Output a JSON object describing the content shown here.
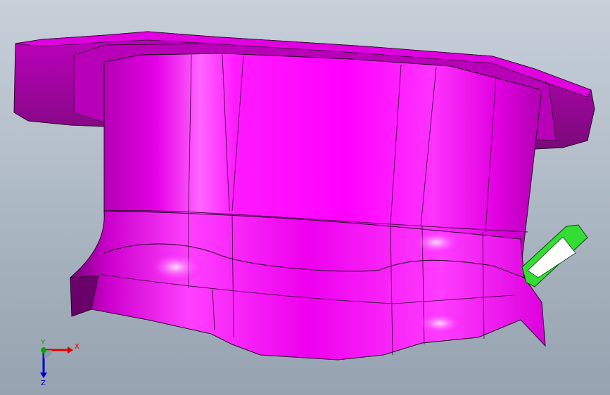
{
  "viewport": {
    "background_top": "#c7d0d9",
    "background_bottom": "#96a3b0"
  },
  "model": {
    "part_color": "#ff00ff",
    "part_shadow_color": "#8a0c8a",
    "tab_color": "#33dd33"
  },
  "triad": {
    "x_label": "X",
    "y_label": "Y",
    "z_label": "Z",
    "x_color": "#e00000",
    "y_color": "#00aa00",
    "z_color": "#0000cc"
  }
}
